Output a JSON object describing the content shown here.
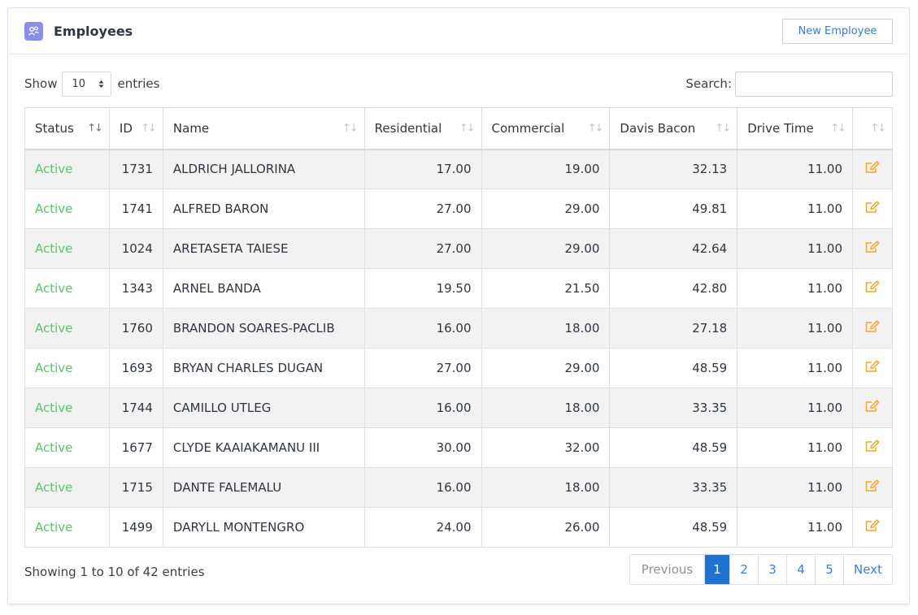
{
  "header": {
    "title": "Employees",
    "new_button_label": "New Employee"
  },
  "controls": {
    "show_label": "Show",
    "page_length": "10",
    "entries_label": "entries",
    "search_label": "Search:",
    "search_value": ""
  },
  "table": {
    "columns": [
      "Status",
      "ID",
      "Name",
      "Residential",
      "Commercial",
      "Davis Bacon",
      "Drive Time",
      ""
    ],
    "rows": [
      {
        "status": "Active",
        "id": "1731",
        "name": "ALDRICH JALLORINA",
        "residential": "17.00",
        "commercial": "19.00",
        "davis_bacon": "32.13",
        "drive_time": "11.00"
      },
      {
        "status": "Active",
        "id": "1741",
        "name": "ALFRED BARON",
        "residential": "27.00",
        "commercial": "29.00",
        "davis_bacon": "49.81",
        "drive_time": "11.00"
      },
      {
        "status": "Active",
        "id": "1024",
        "name": "ARETASETA TAIESE",
        "residential": "27.00",
        "commercial": "29.00",
        "davis_bacon": "42.64",
        "drive_time": "11.00"
      },
      {
        "status": "Active",
        "id": "1343",
        "name": "ARNEL BANDA",
        "residential": "19.50",
        "commercial": "21.50",
        "davis_bacon": "42.80",
        "drive_time": "11.00"
      },
      {
        "status": "Active",
        "id": "1760",
        "name": "BRANDON SOARES-PACLIB",
        "residential": "16.00",
        "commercial": "18.00",
        "davis_bacon": "27.18",
        "drive_time": "11.00"
      },
      {
        "status": "Active",
        "id": "1693",
        "name": "BRYAN CHARLES DUGAN",
        "residential": "27.00",
        "commercial": "29.00",
        "davis_bacon": "48.59",
        "drive_time": "11.00"
      },
      {
        "status": "Active",
        "id": "1744",
        "name": "CAMILLO UTLEG",
        "residential": "16.00",
        "commercial": "18.00",
        "davis_bacon": "33.35",
        "drive_time": "11.00"
      },
      {
        "status": "Active",
        "id": "1677",
        "name": "CLYDE KAAIAKAMANU III",
        "residential": "30.00",
        "commercial": "32.00",
        "davis_bacon": "48.59",
        "drive_time": "11.00"
      },
      {
        "status": "Active",
        "id": "1715",
        "name": "DANTE FALEMALU",
        "residential": "16.00",
        "commercial": "18.00",
        "davis_bacon": "33.35",
        "drive_time": "11.00"
      },
      {
        "status": "Active",
        "id": "1499",
        "name": "DARYLL MONTENGRO",
        "residential": "24.00",
        "commercial": "26.00",
        "davis_bacon": "48.59",
        "drive_time": "11.00"
      }
    ]
  },
  "footer": {
    "info": "Showing 1 to 10 of 42 entries",
    "pagination": {
      "previous": "Previous",
      "pages": [
        "1",
        "2",
        "3",
        "4",
        "5"
      ],
      "next": "Next",
      "current": "1"
    }
  },
  "colors": {
    "active_status": "#5ac46b",
    "accent": "#1f73d0",
    "edit_icon": "#f5a623",
    "header_icon_bg": "#8b8ee8"
  },
  "icons": {
    "header": "employee-group-icon",
    "row_action": "edit-icon",
    "sort": "sort-arrows-icon",
    "select": "select-arrows-icon"
  }
}
